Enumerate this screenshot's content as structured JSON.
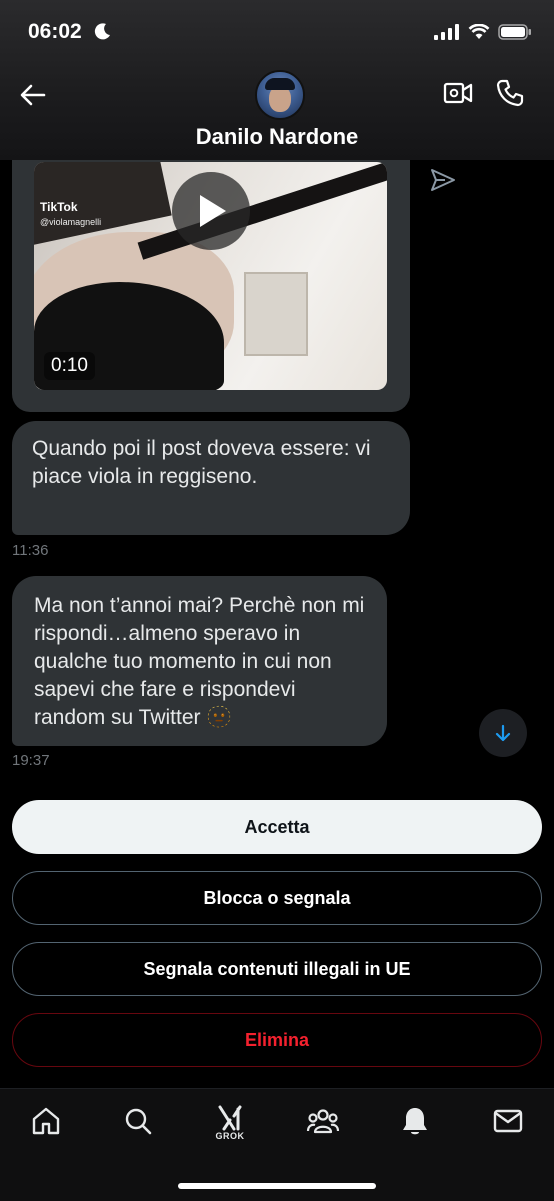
{
  "status_bar": {
    "time": "06:02"
  },
  "header": {
    "contact_name": "Danilo Nardone"
  },
  "media_message": {
    "watermark_logo": "TikTok",
    "watermark_user": "@violamagnelli",
    "duration": "0:10"
  },
  "messages": [
    {
      "text": "Quando poi il post doveva essere: vi piace viola in reggiseno.",
      "time": "11:36"
    },
    {
      "text": "Ma non t’annoi mai? Perchè non mi rispondi…almeno speravo in qualche tuo momento in cui non sapevi che fare e rispondevi random su Twitter 🫥",
      "time": "19:37"
    }
  ],
  "actions": {
    "accept": "Accetta",
    "block_report": "Blocca o segnala",
    "report_illegal": "Segnala contenuti illegali in UE",
    "delete": "Elimina"
  },
  "bottom_nav": {
    "grok_label": "GROK"
  },
  "colors": {
    "background": "#000000",
    "bubble": "#2f3336",
    "accent": "#1d9bf0",
    "danger": "#f4212e"
  }
}
